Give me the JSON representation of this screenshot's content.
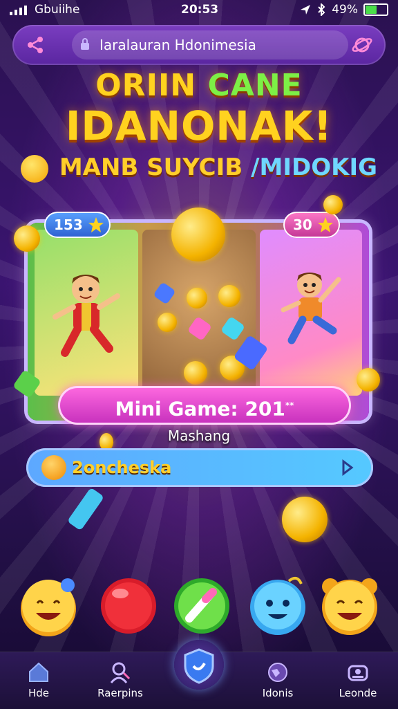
{
  "status_bar": {
    "carrier": "Gbuiihe",
    "time": "20:53",
    "battery": "49%",
    "battery_level": 0.49
  },
  "browser": {
    "url": "Iaralauran Hdonimesia"
  },
  "title": {
    "line1_a": "ORIIN",
    "line1_b": "CANE",
    "line2": "IDANONAK!",
    "line3_a": "MANB SUYCIB",
    "line3_b": "/MIDOKIG"
  },
  "game": {
    "left_score": "153",
    "right_score": "30",
    "banner": "Mini Game: 201",
    "banner_mark": "**",
    "subtitle": "Mashang",
    "action": "2oncheska"
  },
  "nav": [
    {
      "label": "Hde",
      "icon": "home-icon"
    },
    {
      "label": "Raerpins",
      "icon": "profile-icon"
    },
    {
      "label": "",
      "icon": "shield-icon"
    },
    {
      "label": "Idonis",
      "icon": "globe-icon"
    },
    {
      "label": "Leonde",
      "icon": "controller-icon"
    }
  ],
  "colors": {
    "accent": "#ffd21f",
    "banner": "#e045d4",
    "action_bar": "#55c9ff"
  }
}
